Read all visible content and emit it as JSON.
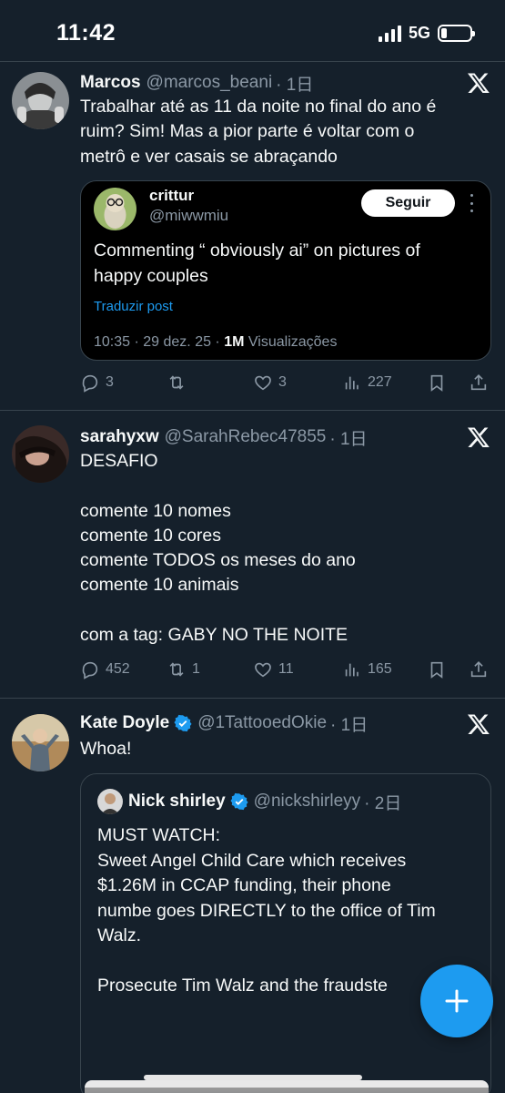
{
  "status_bar": {
    "time": "11:42",
    "network": "5G",
    "battery_level": 0.2
  },
  "posts": [
    {
      "name": "Marcos",
      "handle": "@marcos_beani",
      "time": "· 1日",
      "text": "Trabalhar até as 11 da noite no final do ano é\nruim? Sim! Mas a pior parte é voltar com o\nmetrô e ver casais se abraçando",
      "quote": {
        "name": "crittur",
        "handle": "@miwwmiu",
        "follow_label": "Seguir",
        "text": "Commenting “ obviously ai” on pictures of\nhappy couples",
        "translate": "Traduzir post",
        "meta_time": "10:35 · 29 dez. 25 ·",
        "meta_views_count": "1M",
        "meta_views_label": "Visualizações"
      },
      "stats": {
        "replies": "3",
        "reposts": "",
        "likes": "3",
        "views": "227"
      }
    },
    {
      "name": "sarahyxw",
      "handle": "@SarahRebec47855",
      "time": "· 1日",
      "text": "DESAFIO\n\ncomente 10 nomes\ncomente 10 cores\ncomente TODOS os meses do ano\ncomente 10 animais\n\ncom a tag: GABY NO THE NOITE",
      "stats": {
        "replies": "452",
        "reposts": "1",
        "likes": "11",
        "views": "165"
      }
    },
    {
      "name": "Kate Doyle",
      "handle": "@1TattooedOkie",
      "time": "· 1日",
      "text": "Whoa!",
      "quote": {
        "name": "Nick shirley",
        "handle": "@nickshirleyy",
        "time": "· 2日",
        "text": "MUST WATCH:\nSweet Angel Child Care which receives\n$1.26M in CCAP funding, their phone\nnumbe goes DIRECTLY to the office of Tim\nWalz.\n\nProsecute Tim Walz and the fraudste"
      }
    }
  ],
  "fab": {
    "icon": "plus-icon"
  },
  "colors": {
    "background": "#15202b",
    "accent": "#1d9bf0",
    "muted": "#8b98a5",
    "divider": "#38444d"
  }
}
